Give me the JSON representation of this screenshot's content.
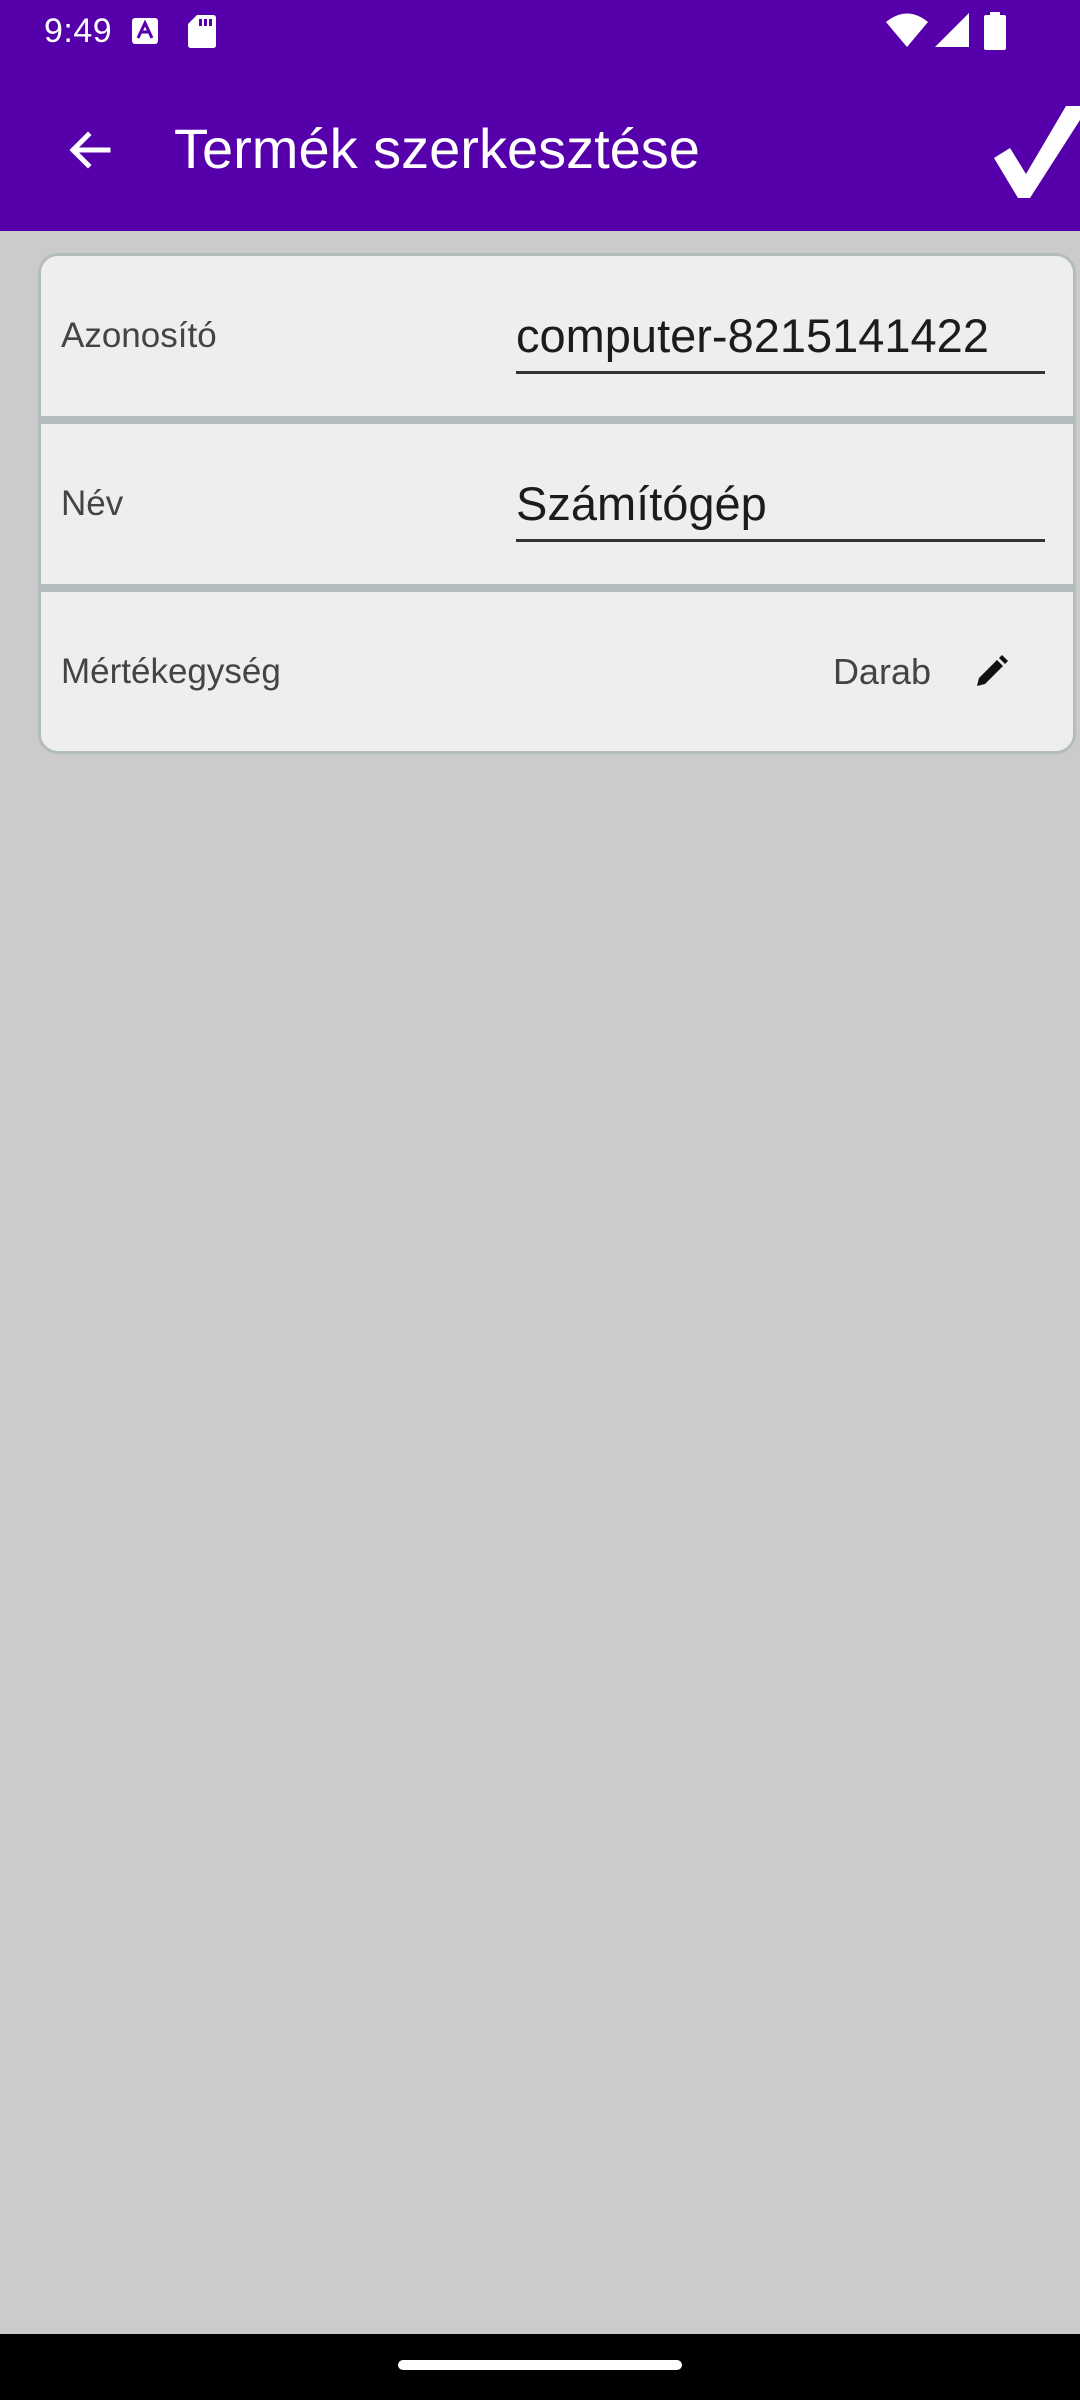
{
  "status_bar": {
    "time": "9:49",
    "icons": [
      "accessibility-a-icon",
      "sd-card-icon",
      "wifi-icon",
      "cell-signal-icon",
      "battery-icon"
    ]
  },
  "app_bar": {
    "title": "Termék szerkesztése",
    "back_icon": "arrow-left-icon",
    "save_icon": "checkmark-icon",
    "background_color": "#5500aa"
  },
  "form": {
    "fields": [
      {
        "label": "Azonosító",
        "value": "computer-8215141422"
      },
      {
        "label": "Név",
        "value": "Számítógép"
      }
    ],
    "unit": {
      "label": "Mértékegység",
      "value": "Darab",
      "edit_icon": "pencil-icon"
    }
  }
}
